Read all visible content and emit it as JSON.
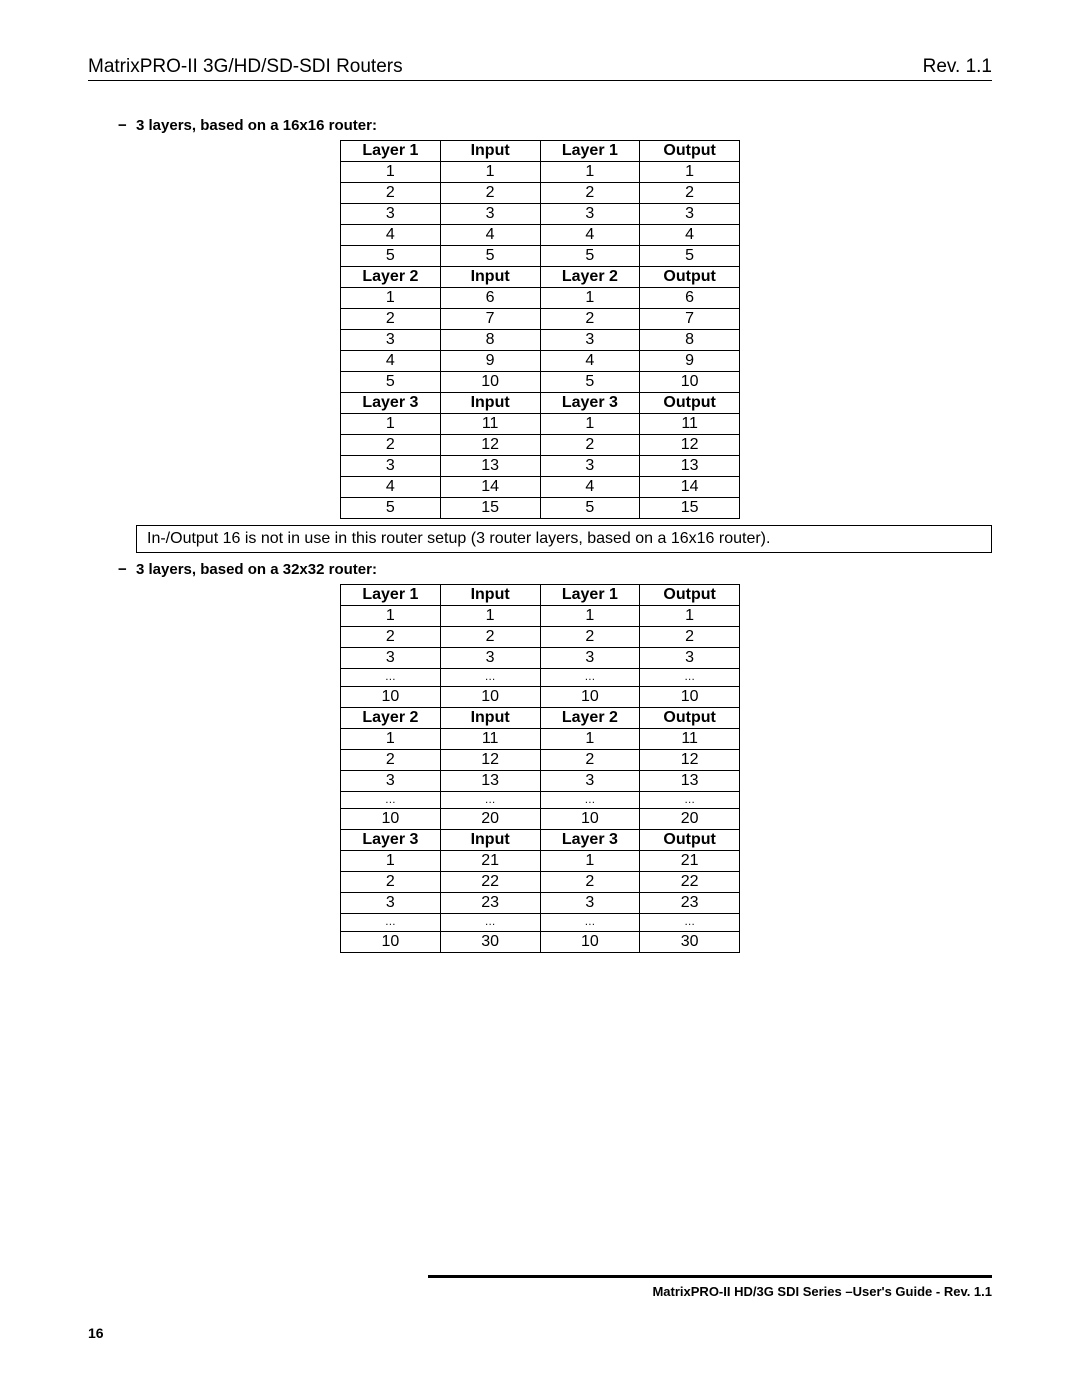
{
  "header": {
    "title": "MatrixPRO-II 3G/HD/SD-SDI Routers",
    "rev": "Rev. 1.1"
  },
  "section1": {
    "bullet": "3 layers, based on a 16x16 router:",
    "headers": [
      {
        "c1": "Layer 1",
        "c2": "Input",
        "c3": "Layer 1",
        "c4": "Output"
      },
      {
        "c1": "Layer 2",
        "c2": "Input",
        "c3": "Layer 2",
        "c4": "Output"
      },
      {
        "c1": "Layer 3",
        "c2": "Input",
        "c3": "Layer 3",
        "c4": "Output"
      }
    ],
    "layer1": [
      {
        "a": "1",
        "b": "1",
        "c": "1",
        "d": "1"
      },
      {
        "a": "2",
        "b": "2",
        "c": "2",
        "d": "2"
      },
      {
        "a": "3",
        "b": "3",
        "c": "3",
        "d": "3"
      },
      {
        "a": "4",
        "b": "4",
        "c": "4",
        "d": "4"
      },
      {
        "a": "5",
        "b": "5",
        "c": "5",
        "d": "5"
      }
    ],
    "layer2": [
      {
        "a": "1",
        "b": "6",
        "c": "1",
        "d": "6"
      },
      {
        "a": "2",
        "b": "7",
        "c": "2",
        "d": "7"
      },
      {
        "a": "3",
        "b": "8",
        "c": "3",
        "d": "8"
      },
      {
        "a": "4",
        "b": "9",
        "c": "4",
        "d": "9"
      },
      {
        "a": "5",
        "b": "10",
        "c": "5",
        "d": "10"
      }
    ],
    "layer3": [
      {
        "a": "1",
        "b": "11",
        "c": "1",
        "d": "11"
      },
      {
        "a": "2",
        "b": "12",
        "c": "2",
        "d": "12"
      },
      {
        "a": "3",
        "b": "13",
        "c": "3",
        "d": "13"
      },
      {
        "a": "4",
        "b": "14",
        "c": "4",
        "d": "14"
      },
      {
        "a": "5",
        "b": "15",
        "c": "5",
        "d": "15"
      }
    ],
    "note": "In-/Output 16 is not in use in this router setup (3 router layers, based on a 16x16 router)."
  },
  "section2": {
    "bullet": "3 layers, based on a 32x32 router:",
    "headers": [
      {
        "c1": "Layer 1",
        "c2": "Input",
        "c3": "Layer 1",
        "c4": "Output"
      },
      {
        "c1": "Layer 2",
        "c2": "Input",
        "c3": "Layer 2",
        "c4": "Output"
      },
      {
        "c1": "Layer 3",
        "c2": "Input",
        "c3": "Layer 3",
        "c4": "Output"
      }
    ],
    "layer1": [
      {
        "a": "1",
        "b": "1",
        "c": "1",
        "d": "1"
      },
      {
        "a": "2",
        "b": "2",
        "c": "2",
        "d": "2"
      },
      {
        "a": "3",
        "b": "3",
        "c": "3",
        "d": "3"
      },
      {
        "ell": true
      },
      {
        "a": "10",
        "b": "10",
        "c": "10",
        "d": "10"
      }
    ],
    "layer2": [
      {
        "a": "1",
        "b": "11",
        "c": "1",
        "d": "11"
      },
      {
        "a": "2",
        "b": "12",
        "c": "2",
        "d": "12"
      },
      {
        "a": "3",
        "b": "13",
        "c": "3",
        "d": "13"
      },
      {
        "ell": true
      },
      {
        "a": "10",
        "b": "20",
        "c": "10",
        "d": "20"
      }
    ],
    "layer3": [
      {
        "a": "1",
        "b": "21",
        "c": "1",
        "d": "21"
      },
      {
        "a": "2",
        "b": "22",
        "c": "2",
        "d": "22"
      },
      {
        "a": "3",
        "b": "23",
        "c": "3",
        "d": "23"
      },
      {
        "ell": true
      },
      {
        "a": "10",
        "b": "30",
        "c": "10",
        "d": "30"
      }
    ]
  },
  "footer": {
    "text": "MatrixPRO-II HD/3G SDI Series –User's Guide - Rev. 1.1",
    "page": "16"
  },
  "ellipsis": "…"
}
